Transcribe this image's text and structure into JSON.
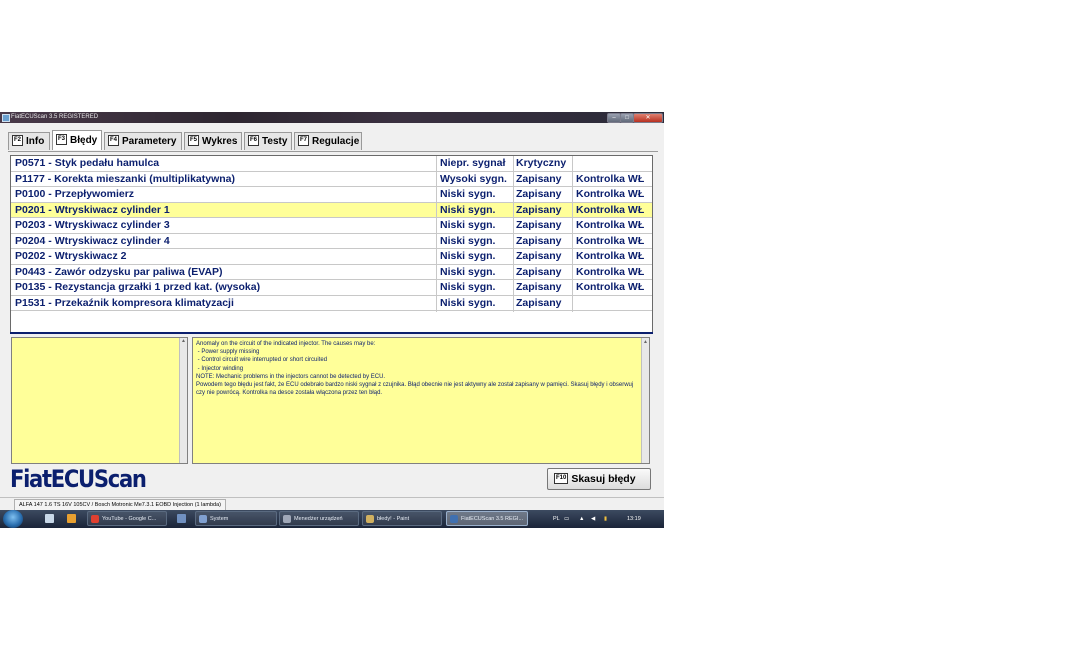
{
  "window": {
    "title": "FiatECUScan 3.5 REGISTERED",
    "minimize": "–",
    "maximize": "□",
    "close": "✕"
  },
  "tabs": [
    {
      "key": "F2",
      "label": "Info"
    },
    {
      "key": "F3",
      "label": "Błędy"
    },
    {
      "key": "F4",
      "label": "Parametery"
    },
    {
      "key": "F5",
      "label": "Wykres"
    },
    {
      "key": "F6",
      "label": "Testy"
    },
    {
      "key": "F7",
      "label": "Regulacje"
    }
  ],
  "errors": [
    {
      "code": "P0571 - Styk pedału hamulca",
      "signal": "Niepr. sygnał",
      "status": "Krytyczny",
      "lamp": ""
    },
    {
      "code": "P1177 - Korekta mieszanki (multiplikatywna)",
      "signal": "Wysoki sygn.",
      "status": "Zapisany",
      "lamp": "Kontrolka WŁ"
    },
    {
      "code": "P0100 - Przepływomierz",
      "signal": "Niski sygn.",
      "status": "Zapisany",
      "lamp": "Kontrolka WŁ"
    },
    {
      "code": "P0201 - Wtryskiwacz cylinder 1",
      "signal": "Niski sygn.",
      "status": "Zapisany",
      "lamp": "Kontrolka WŁ"
    },
    {
      "code": "P0203 - Wtryskiwacz cylinder 3",
      "signal": "Niski sygn.",
      "status": "Zapisany",
      "lamp": "Kontrolka WŁ"
    },
    {
      "code": "P0204 - Wtryskiwacz cylinder 4",
      "signal": "Niski sygn.",
      "status": "Zapisany",
      "lamp": "Kontrolka WŁ"
    },
    {
      "code": "P0202 - Wtryskiwacz 2",
      "signal": "Niski sygn.",
      "status": "Zapisany",
      "lamp": "Kontrolka WŁ"
    },
    {
      "code": "P0443 - Zawór odzysku par paliwa (EVAP)",
      "signal": "Niski sygn.",
      "status": "Zapisany",
      "lamp": "Kontrolka WŁ"
    },
    {
      "code": "P0135 - Rezystancja grzałki 1 przed kat. (wysoka)",
      "signal": "Niski sygn.",
      "status": "Zapisany",
      "lamp": "Kontrolka WŁ"
    },
    {
      "code": "P1531 - Przekaźnik kompresora klimatyzacji",
      "signal": "Niski sygn.",
      "status": "Zapisany",
      "lamp": ""
    }
  ],
  "description": {
    "lines": [
      "Anomaly on the circuit of the indicated injector. The causes may be:",
      " - Power supply missing",
      " - Control circuit wire interrupted or short circuited",
      " - Injector winding",
      "NOTE: Mechanic problems in the injectors cannot be detected by ECU.",
      "Powodem tego błędu jest fakt, że ECU odebrało bardzo niski sygnał z czujnika. Błąd obecnie nie jest aktywny ale został zapisany w pamięci. Skasuj błędy i obserwuj czy nie powrócą. Kontrolka na desce została włączona przez ten błąd."
    ]
  },
  "logo": "FiatECUScan",
  "clear_button": {
    "key": "F10",
    "label": "Skasuj błędy"
  },
  "status": "ALFA 147 1.6 TS 16V 105CV / Bosch Motronic Me7.3.1 EOBD Injection (1 lambda)",
  "taskbar": {
    "items": [
      {
        "label": "YouTube - Google C...",
        "icon": "chrome-icon"
      },
      {
        "label": "System",
        "icon": "system-icon"
      },
      {
        "label": "Menedżer urządzeń",
        "icon": "device-manager-icon"
      },
      {
        "label": "błedy! - Paint",
        "icon": "paint-icon"
      },
      {
        "label": "FiatECUScan 3.5 REGI...",
        "icon": "fiatecuscan-icon"
      }
    ],
    "language": "PL",
    "clock": "13:19"
  }
}
